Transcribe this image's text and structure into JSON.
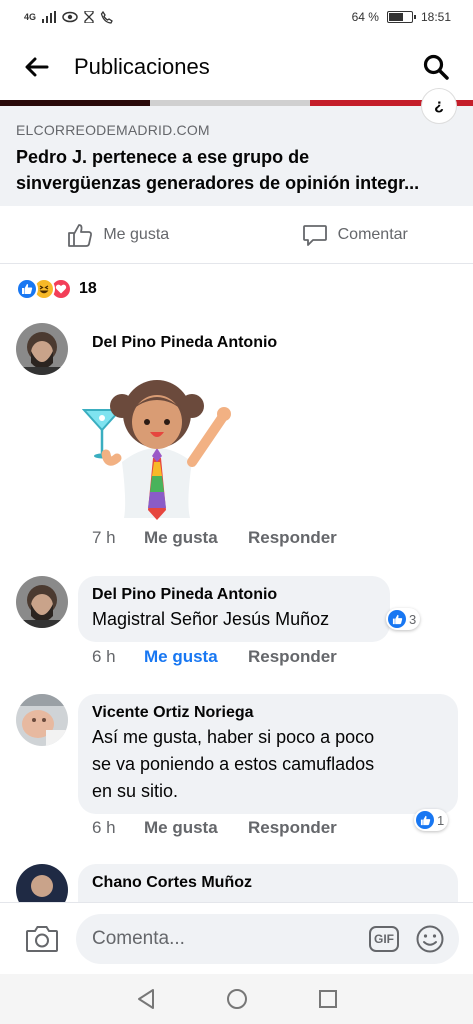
{
  "status_bar": {
    "network": "4G",
    "battery_percent": "64 %",
    "battery_level": 0.64,
    "time": "18:51"
  },
  "header": {
    "title": "Publicaciones"
  },
  "link_preview": {
    "info_glyph": "¿",
    "domain": "ELCORREODEMADRID.COM",
    "title": "Pedro J. pertenece a ese grupo de\nsinvergüenzas generadores de opinión integr..."
  },
  "actions": {
    "like_label": "Me gusta",
    "comment_label": "Comentar"
  },
  "reactions": {
    "types": [
      "like",
      "haha",
      "love"
    ],
    "count": "18"
  },
  "comments": [
    {
      "author": "Del Pino Pineda Antonio",
      "text": "",
      "sticker": "bartender-girl-sticker",
      "time": "7 h",
      "like_label": "Me gusta",
      "reply_label": "Responder",
      "liked": false,
      "reaction_count": ""
    },
    {
      "author": "Del Pino Pineda Antonio",
      "text": "Magistral Señor Jesús Muñoz",
      "time": "6 h",
      "like_label": "Me gusta",
      "reply_label": "Responder",
      "liked": true,
      "reaction_count": "3"
    },
    {
      "author": "Vicente Ortiz Noriega",
      "text": "Así me gusta, haber si poco a poco\nse va poniendo a estos camuflados\nen su sitio.",
      "time": "6 h",
      "like_label": "Me gusta",
      "reply_label": "Responder",
      "liked": false,
      "reaction_count": "1"
    },
    {
      "author": "Chano Cortes Muñoz",
      "text": "",
      "time": "",
      "like_label": "",
      "reply_label": "",
      "liked": false,
      "reaction_count": ""
    }
  ],
  "composer": {
    "placeholder": "Comenta...",
    "gif_label": "GIF"
  },
  "colors": {
    "accent": "#1877f2",
    "muted_text": "#65676b",
    "bubble_bg": "#f0f2f5"
  }
}
